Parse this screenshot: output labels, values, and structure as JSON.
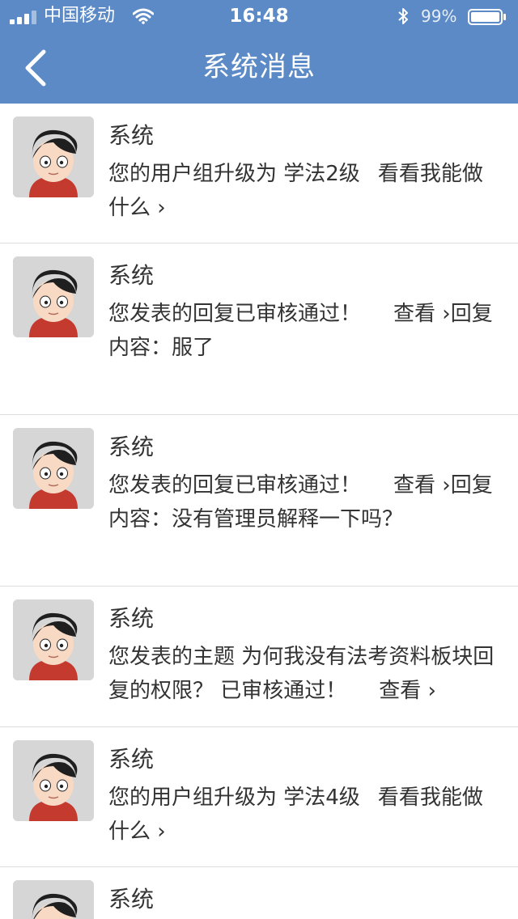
{
  "status_bar": {
    "carrier": "中国移动",
    "time": "16:48",
    "battery_text": "99%"
  },
  "nav": {
    "title": "系统消息"
  },
  "messages": [
    {
      "sender": "系统",
      "text": "您的用户组升级为 学法2级",
      "link": "看看我能做什么 ›"
    },
    {
      "sender": "系统",
      "text": "您发表的回复已审核通过！",
      "link": "查看 ›",
      "extra": "回复内容：服了"
    },
    {
      "sender": "系统",
      "text": "您发表的回复已审核通过！",
      "link": "查看 ›",
      "extra": "回复内容：没有管理员解释一下吗？"
    },
    {
      "sender": "系统",
      "text": "您发表的主题 为何我没有法考资料板块回复的权限？ 已审核通过！",
      "link": "查看 ›"
    },
    {
      "sender": "系统",
      "text": "您的用户组升级为 学法4级",
      "link": "看看我能做什么 ›"
    },
    {
      "sender": "系统",
      "text": ""
    }
  ],
  "colors": {
    "header_bg": "#5b8ac6",
    "avatar_bg": "#d6d6d6",
    "divider": "#dcdcdc"
  },
  "icons": [
    "signal-icon",
    "wifi-icon",
    "bluetooth-icon",
    "battery-icon",
    "back-chevron-icon",
    "avatar-icon"
  ]
}
